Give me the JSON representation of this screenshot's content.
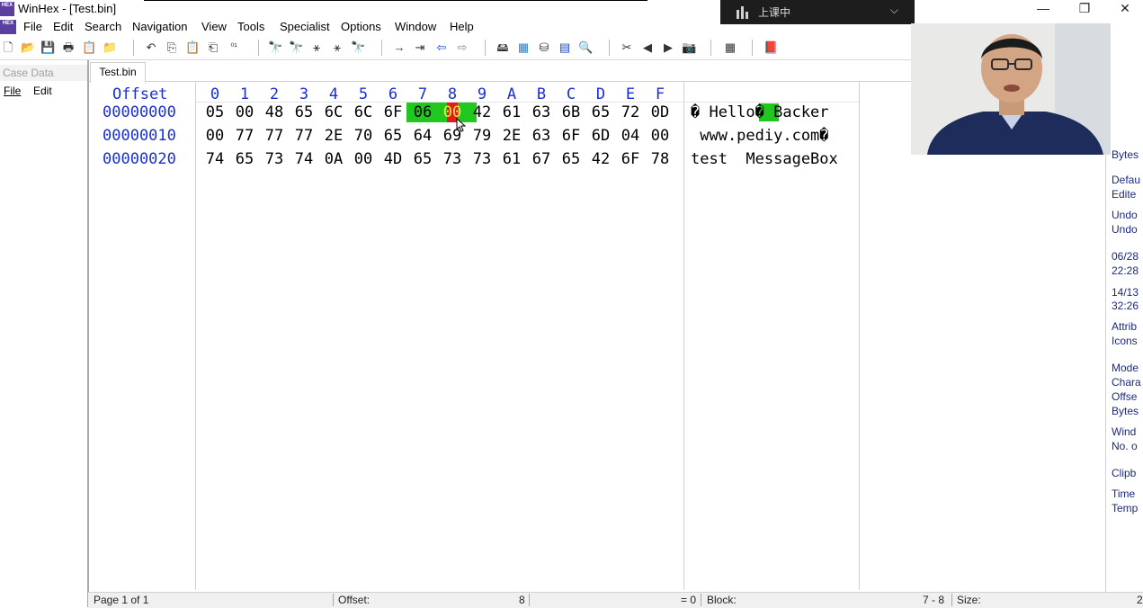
{
  "window": {
    "title": "WinHex - [Test.bin]",
    "app_icon_text": "HEX",
    "controls": {
      "minimize": "—",
      "restore": "❐",
      "close": "✕"
    }
  },
  "classroom": {
    "label": "上课中",
    "chevron": "⌵"
  },
  "menu": [
    "File",
    "Edit",
    "Search",
    "Navigation",
    "View",
    "Tools",
    "Specialist",
    "Options",
    "Window",
    "Help"
  ],
  "toolbar_icons": [
    {
      "name": "new-file-icon",
      "glyph": "🗋"
    },
    {
      "name": "open-icon",
      "glyph": "📂"
    },
    {
      "name": "save-icon",
      "glyph": "💾"
    },
    {
      "name": "print-icon",
      "glyph": "🖶"
    },
    {
      "name": "properties-icon",
      "glyph": "📋"
    },
    {
      "name": "open-folder-icon",
      "glyph": "📁"
    },
    {
      "name": "undo-icon",
      "glyph": "↶"
    },
    {
      "name": "copy-icon",
      "glyph": "⎘"
    },
    {
      "name": "paste-icon",
      "glyph": "📋"
    },
    {
      "name": "paste-special-icon",
      "glyph": "⎗"
    },
    {
      "name": "binary-icon",
      "glyph": "⁰¹"
    },
    {
      "name": "find-icon",
      "glyph": "🔭"
    },
    {
      "name": "find-hex-icon",
      "glyph": "🔭"
    },
    {
      "name": "replace-icon",
      "glyph": "⚹"
    },
    {
      "name": "replace-hex-icon",
      "glyph": "⚹"
    },
    {
      "name": "find-next-icon",
      "glyph": "🔭"
    },
    {
      "name": "goto-icon",
      "glyph": "→"
    },
    {
      "name": "goto-offset-icon",
      "glyph": "⇥"
    },
    {
      "name": "back-icon",
      "glyph": "⇦"
    },
    {
      "name": "forward-icon",
      "glyph": "⇨"
    },
    {
      "name": "disk-icon",
      "glyph": "🖴"
    },
    {
      "name": "ram-icon",
      "glyph": "▦"
    },
    {
      "name": "disk-tools-icon",
      "glyph": "⛁"
    },
    {
      "name": "calculator-icon",
      "glyph": "▤"
    },
    {
      "name": "zoom-icon",
      "glyph": "🔍"
    },
    {
      "name": "cut-icon",
      "glyph": "✂"
    },
    {
      "name": "prev-icon",
      "glyph": "◀"
    },
    {
      "name": "next-icon",
      "glyph": "▶"
    },
    {
      "name": "camera-icon",
      "glyph": "📷"
    },
    {
      "name": "table-icon",
      "glyph": "▦"
    },
    {
      "name": "book-icon",
      "glyph": "📕"
    }
  ],
  "case_panel": {
    "header": "Case Data",
    "menu_file": "File",
    "menu_edit": "Edit"
  },
  "tab": "Test.bin",
  "hex": {
    "offset_label": "Offset",
    "columns": [
      "0",
      "1",
      "2",
      "3",
      "4",
      "5",
      "6",
      "7",
      "8",
      "9",
      "A",
      "B",
      "C",
      "D",
      "E",
      "F"
    ],
    "rows": [
      {
        "offset": "00000000",
        "bytes": [
          "05",
          "00",
          "48",
          "65",
          "6C",
          "6C",
          "6F",
          "06",
          "00",
          "42",
          "61",
          "63",
          "6B",
          "65",
          "72",
          "0D"
        ],
        "ascii": "� Hello� Backer"
      },
      {
        "offset": "00000010",
        "bytes": [
          "00",
          "77",
          "77",
          "77",
          "2E",
          "70",
          "65",
          "64",
          "69",
          "79",
          "2E",
          "63",
          "6F",
          "6D",
          "04",
          "00"
        ],
        "ascii": " www.pediy.com�"
      },
      {
        "offset": "00000020",
        "bytes": [
          "74",
          "65",
          "73",
          "74",
          "0A",
          "00",
          "4D",
          "65",
          "73",
          "73",
          "61",
          "67",
          "65",
          "42",
          "6F",
          "78"
        ],
        "ascii": "test  MessageBox"
      }
    ]
  },
  "right_panel": [
    "Bytes",
    "Defau",
    "Edite",
    "Undo",
    "Undo",
    "06/28",
    "22:28",
    "14/13",
    "32:26",
    "Attrib",
    "Icons",
    "Mode",
    "Chara",
    "Offse",
    "Bytes",
    "Wind",
    "No. o",
    "Clipb",
    "Time",
    "Temp"
  ],
  "status": {
    "page": "Page 1 of 1",
    "offset_label": "Offset:",
    "offset_value": "8",
    "equals": "= 0",
    "block_label": "Block:",
    "block_value": "7 - 8",
    "size_label": "Size:",
    "size_value": "2"
  },
  "colors": {
    "offset_blue": "#1a2fd0",
    "selection_green": "#1fc71f",
    "cursor_red": "#e01c1c"
  }
}
